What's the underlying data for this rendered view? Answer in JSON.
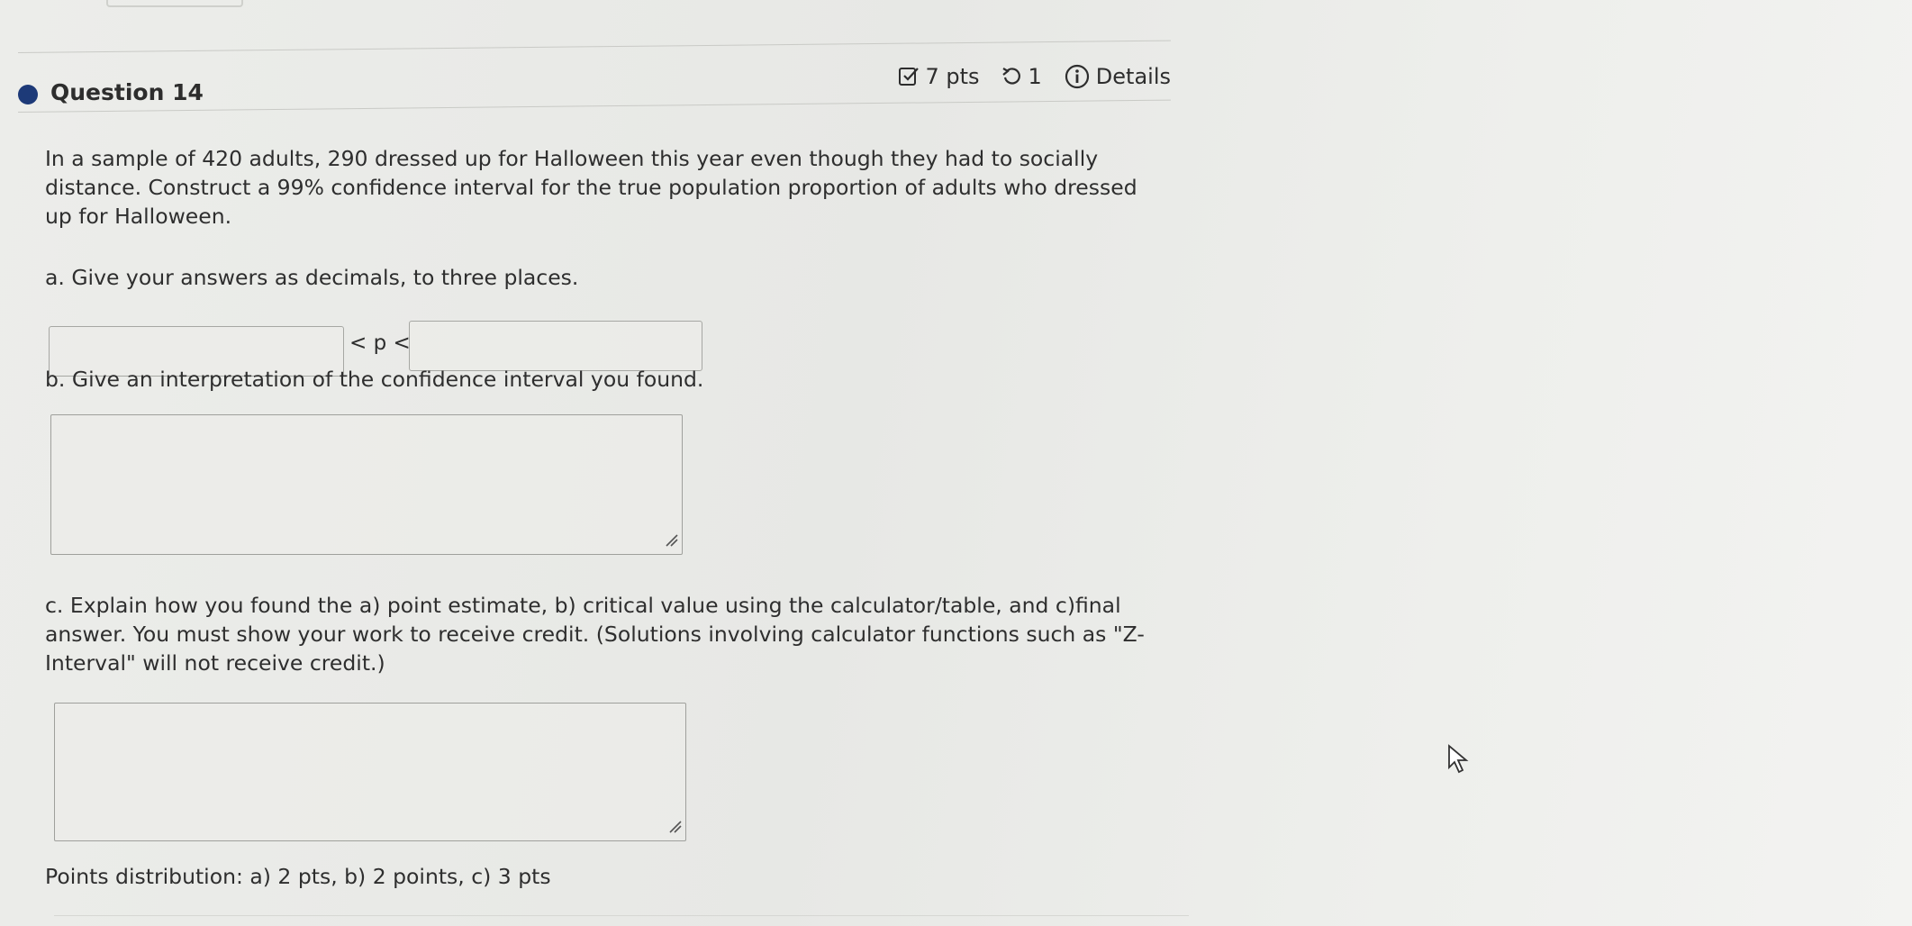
{
  "question": {
    "title": "Question 14",
    "points": "7 pts",
    "attempts": "1",
    "details_label": "Details"
  },
  "prompt": {
    "intro": "In a sample of 420 adults, 290 dressed up for Halloween this year even though they had to socially distance. Construct a 99% confidence interval for the true population proportion of adults who dressed up for Halloween.",
    "part_a": "a. Give your answers as decimals, to three places.",
    "interval_symbol": "< p <",
    "part_b": "b. Give an interpretation of the confidence interval you found.",
    "part_c": "c. Explain how you found the a) point estimate, b) critical value using the calculator/table, and c)final answer. You must show your work to receive credit. (Solutions involving calculator functions such as \"Z-Interval\" will not receive credit.)",
    "points_distribution": "Points distribution: a) 2 pts, b) 2 points, c) 3 pts"
  },
  "inputs": {
    "lower_bound": "",
    "upper_bound": "",
    "interpretation": "",
    "explanation": ""
  },
  "colors": {
    "accent_dot": "#1d3a78",
    "background": "#e9eae7",
    "text": "#2e2e2e"
  }
}
